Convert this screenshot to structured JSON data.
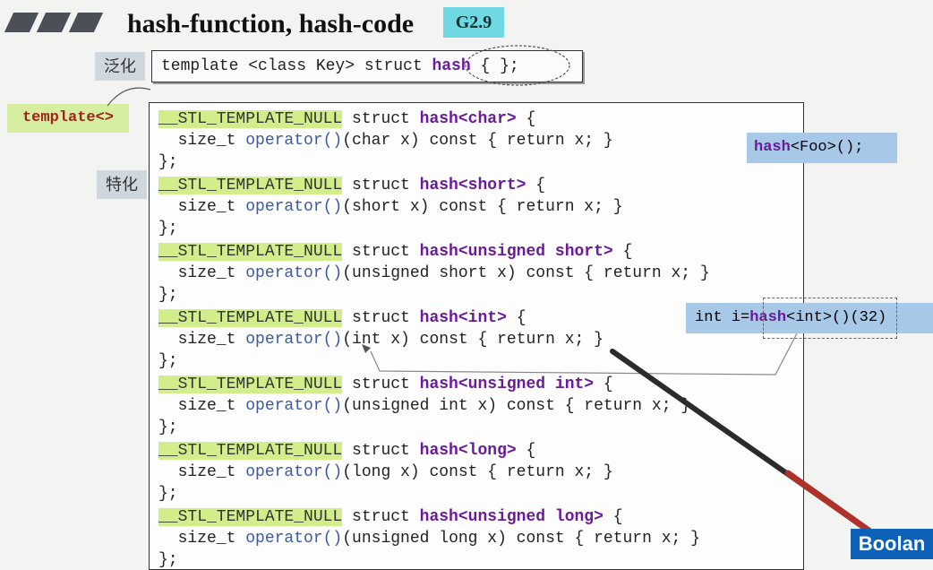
{
  "title": "hash-function, hash-code",
  "badge": "G2.9",
  "tags": {
    "generic": "泛化",
    "special": "特化"
  },
  "template_decl": {
    "prefix": "template <class Key> struct ",
    "name": "hash",
    "suffix": " { };"
  },
  "template_specialization": "template<>",
  "notes": {
    "foo": {
      "name": "hash",
      "rest": "<Foo>();"
    },
    "int_example": {
      "prefix": "int i=",
      "name": "hash",
      "rest": "<int>()(32)"
    }
  },
  "null_macro": "__STL_TEMPLATE_NULL",
  "struct_kw": " struct ",
  "size_t": "  size_t ",
  "operator": "operator()",
  "closing": "};",
  "specializations": [
    {
      "type": "<char>",
      "param": "(char x) const { return x; }"
    },
    {
      "type": "<short>",
      "param": "(short x) const { return x; }"
    },
    {
      "type": "<unsigned short>",
      "param": "(unsigned short x) const { return x; }"
    },
    {
      "type": "<int>",
      "param": "(int x) const { return x; }"
    },
    {
      "type": "<unsigned int>",
      "param": "(unsigned int x) const { return x; }"
    },
    {
      "type": "<long>",
      "param": "(long x) const { return x; }"
    },
    {
      "type": "<unsigned long>",
      "param": "(unsigned long x) const { return x; }"
    }
  ],
  "brand": "Boolan"
}
